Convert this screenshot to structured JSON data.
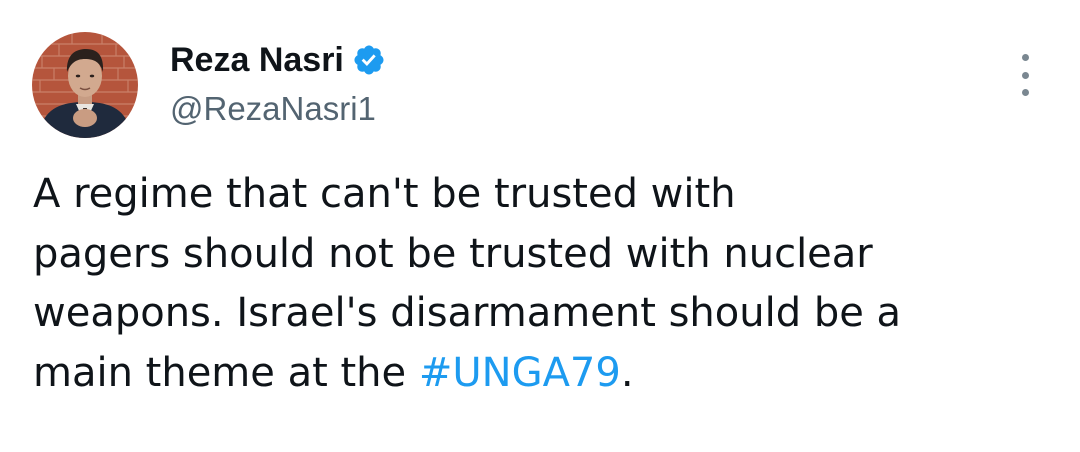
{
  "author": {
    "display_name": "Reza Nasri",
    "handle": "@RezaNasri1",
    "verified_icon": "verified-badge-icon",
    "verified_color": "#1d9bf0"
  },
  "menu": {
    "icon": "more-options-icon"
  },
  "tweet": {
    "lines": [
      "A regime that can't be trusted with",
      "pagers should not be trusted with nuclear",
      "weapons. Israel's disarmament should be a"
    ],
    "last_line_prefix": "main theme at the ",
    "hashtag": "#UNGA79",
    "last_line_suffix": ".",
    "hashtag_color": "#1d9bf0"
  }
}
